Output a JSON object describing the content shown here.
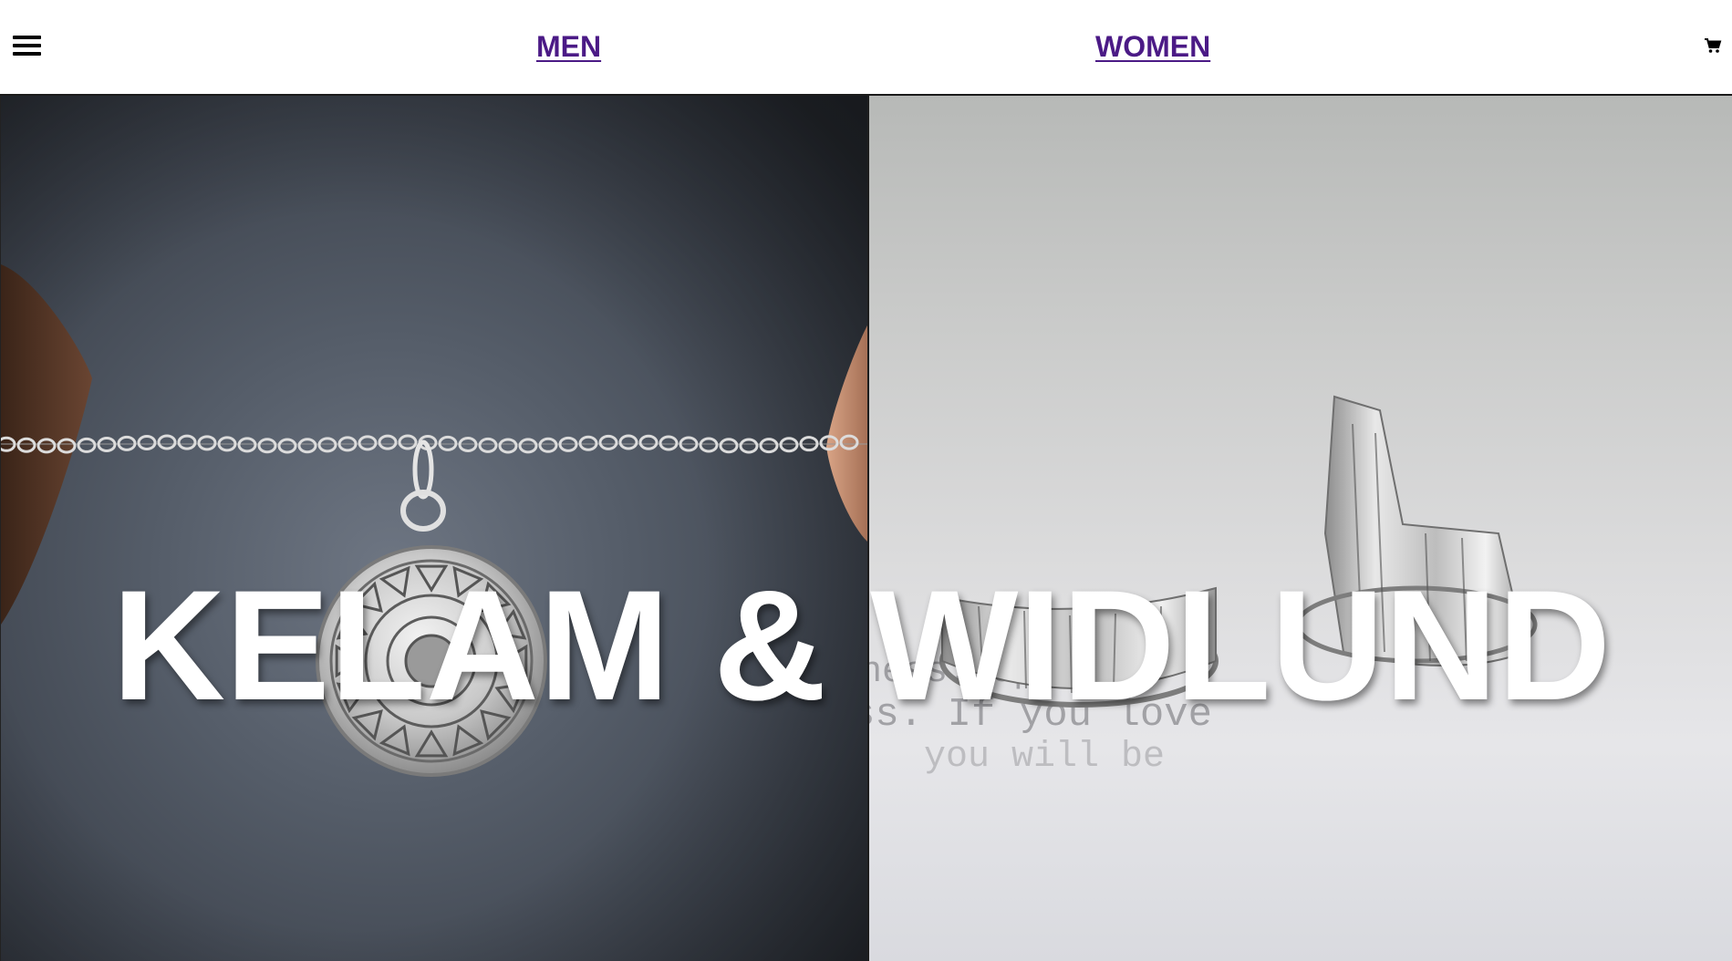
{
  "header": {
    "menu_icon": "hamburger-menu-icon",
    "nav": [
      {
        "label": "MEN"
      },
      {
        "label": "WOMEN"
      }
    ],
    "cart_icon": "shopping-cart-icon",
    "link_color": "#4b1a86"
  },
  "hero": {
    "title": "KELAM & WIDLUND",
    "left_image": "silver-coin-pendant-necklace",
    "right_image": "textured-silver-rings-on-typed-paper"
  }
}
